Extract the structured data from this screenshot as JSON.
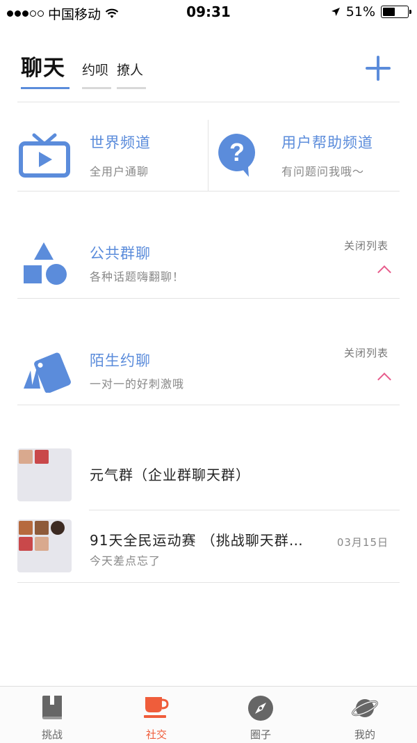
{
  "status_bar": {
    "carrier": "中国移动",
    "time": "09:31",
    "battery": "51%",
    "battery_level": 0.51,
    "signal_bars": 3
  },
  "header": {
    "tabs": [
      {
        "label": "聊天",
        "active": true
      },
      {
        "label": "约呗",
        "active": false
      },
      {
        "label": "撩人",
        "active": false
      }
    ],
    "add_icon": "plus-icon"
  },
  "channels": [
    {
      "title": "世界频道",
      "subtitle": "全用户通聊",
      "icon": "tv-icon"
    },
    {
      "title": "用户帮助频道",
      "subtitle": "有问题问我哦～",
      "icon": "help-bubble-icon"
    }
  ],
  "sections": [
    {
      "title": "公共群聊",
      "subtitle": "各种话题嗨翻聊！",
      "close_label": "关闭列表",
      "icon": "shapes-icon"
    },
    {
      "title": "陌生约聊",
      "subtitle": "一对一的好刺激哦",
      "close_label": "关闭列表",
      "icon": "cards-icon"
    }
  ],
  "chats": [
    {
      "name": "元气群（企业群聊天群）",
      "last_message": "",
      "date": ""
    },
    {
      "name": "91天全民运动赛  （挑战聊天群…",
      "last_message": "今天差点忘了",
      "date": "03月15日"
    }
  ],
  "tabbar": [
    {
      "label": "挑战",
      "icon": "book-icon",
      "active": false
    },
    {
      "label": "社交",
      "icon": "cup-icon",
      "active": true
    },
    {
      "label": "圈子",
      "icon": "compass-icon",
      "active": false
    },
    {
      "label": "我的",
      "icon": "planet-icon",
      "active": false
    }
  ],
  "colors": {
    "accent": "#5b8cdb",
    "pink": "#e75b8b",
    "tab_active": "#ef5d3b"
  }
}
